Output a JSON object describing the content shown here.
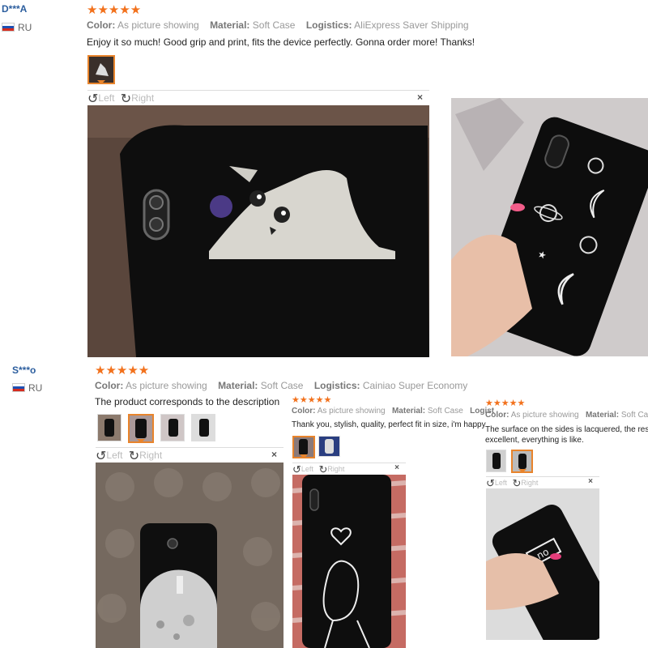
{
  "reviews": [
    {
      "user": "D***A",
      "country": "RU",
      "stars": "★★★★★",
      "color_label": "Color:",
      "color_value": "As picture showing",
      "material_label": "Material:",
      "material_value": "Soft Case",
      "logistics_label": "Logistics:",
      "logistics_value": "AliExpress Saver Shipping",
      "text": "Enjoy it so much! Good grip and print, fits the device perfectly. Gonna order more! Thanks!",
      "toolbar": {
        "left": "Left",
        "right": "Right",
        "close": "×"
      }
    },
    {
      "user": "S***o",
      "country": "RU",
      "stars": "★★★★★",
      "color_label": "Color:",
      "color_value": "As picture showing",
      "material_label": "Material:",
      "material_value": "Soft Case",
      "logistics_label": "Logistics:",
      "logistics_value": "Cainiao Super Economy",
      "text": "The product corresponds to the description",
      "toolbar": {
        "left": "Left",
        "right": "Right",
        "close": "×"
      }
    },
    {
      "stars": "★★★★★",
      "color_label": "Color:",
      "color_value": "As picture showing",
      "material_label": "Material:",
      "material_value": "Soft Case",
      "logistics_label": "Logist",
      "text": "Thank you, stylish, quality, perfect fit in size, i'm happy",
      "toolbar": {
        "left": "Left",
        "right": "Right",
        "close": "×"
      }
    },
    {
      "stars": "★★★★★",
      "color_label": "Color:",
      "color_value": "As picture showing",
      "material_label": "Material:",
      "material_value": "Soft Case",
      "text_line1": "The surface on the sides is lacquered, the rest is",
      "text_line2": "excellent, everything is like.",
      "toolbar": {
        "left": "Left",
        "right": "Right",
        "close": "×"
      }
    }
  ],
  "icons": {
    "rotate_left": "↺",
    "rotate_right": "↻"
  },
  "photo_text": {
    "no_case_label": "no"
  },
  "colors": {
    "star": "#f2711c",
    "username": "#2c5e9e",
    "thumb_selected": "#e8842c"
  }
}
